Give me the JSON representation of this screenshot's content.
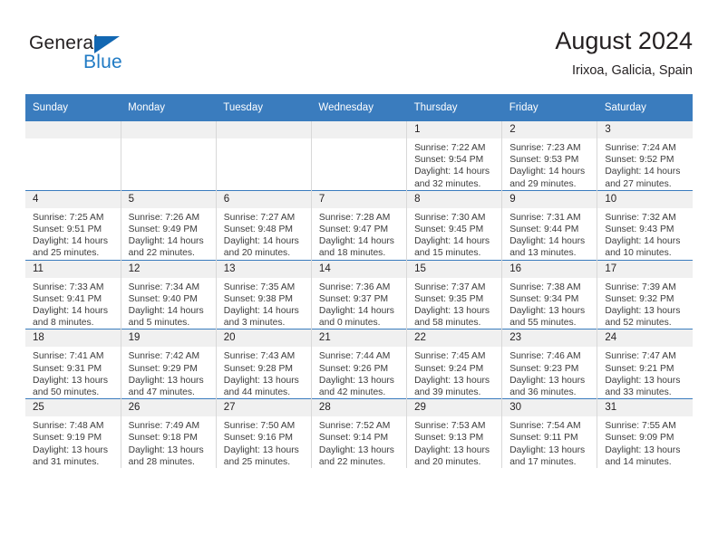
{
  "brand": {
    "name_part1": "General",
    "name_part2": "Blue",
    "logo_color": "#1267b2",
    "accent_color": "#1f7ac4"
  },
  "header": {
    "title": "August 2024",
    "subtitle": "Irixoa, Galicia, Spain"
  },
  "theme": {
    "header_row_color": "#3a7cbe",
    "daynum_band_color": "#f0f0f0",
    "text_color": "#231f20"
  },
  "calendar": {
    "weekday_headers": [
      "Sunday",
      "Monday",
      "Tuesday",
      "Wednesday",
      "Thursday",
      "Friday",
      "Saturday"
    ],
    "weeks": [
      [
        {
          "day": "",
          "sunrise": "",
          "sunset": "",
          "daylight_line1": "",
          "daylight_line2": ""
        },
        {
          "day": "",
          "sunrise": "",
          "sunset": "",
          "daylight_line1": "",
          "daylight_line2": ""
        },
        {
          "day": "",
          "sunrise": "",
          "sunset": "",
          "daylight_line1": "",
          "daylight_line2": ""
        },
        {
          "day": "",
          "sunrise": "",
          "sunset": "",
          "daylight_line1": "",
          "daylight_line2": ""
        },
        {
          "day": "1",
          "sunrise": "Sunrise: 7:22 AM",
          "sunset": "Sunset: 9:54 PM",
          "daylight_line1": "Daylight: 14 hours",
          "daylight_line2": "and 32 minutes."
        },
        {
          "day": "2",
          "sunrise": "Sunrise: 7:23 AM",
          "sunset": "Sunset: 9:53 PM",
          "daylight_line1": "Daylight: 14 hours",
          "daylight_line2": "and 29 minutes."
        },
        {
          "day": "3",
          "sunrise": "Sunrise: 7:24 AM",
          "sunset": "Sunset: 9:52 PM",
          "daylight_line1": "Daylight: 14 hours",
          "daylight_line2": "and 27 minutes."
        }
      ],
      [
        {
          "day": "4",
          "sunrise": "Sunrise: 7:25 AM",
          "sunset": "Sunset: 9:51 PM",
          "daylight_line1": "Daylight: 14 hours",
          "daylight_line2": "and 25 minutes."
        },
        {
          "day": "5",
          "sunrise": "Sunrise: 7:26 AM",
          "sunset": "Sunset: 9:49 PM",
          "daylight_line1": "Daylight: 14 hours",
          "daylight_line2": "and 22 minutes."
        },
        {
          "day": "6",
          "sunrise": "Sunrise: 7:27 AM",
          "sunset": "Sunset: 9:48 PM",
          "daylight_line1": "Daylight: 14 hours",
          "daylight_line2": "and 20 minutes."
        },
        {
          "day": "7",
          "sunrise": "Sunrise: 7:28 AM",
          "sunset": "Sunset: 9:47 PM",
          "daylight_line1": "Daylight: 14 hours",
          "daylight_line2": "and 18 minutes."
        },
        {
          "day": "8",
          "sunrise": "Sunrise: 7:30 AM",
          "sunset": "Sunset: 9:45 PM",
          "daylight_line1": "Daylight: 14 hours",
          "daylight_line2": "and 15 minutes."
        },
        {
          "day": "9",
          "sunrise": "Sunrise: 7:31 AM",
          "sunset": "Sunset: 9:44 PM",
          "daylight_line1": "Daylight: 14 hours",
          "daylight_line2": "and 13 minutes."
        },
        {
          "day": "10",
          "sunrise": "Sunrise: 7:32 AM",
          "sunset": "Sunset: 9:43 PM",
          "daylight_line1": "Daylight: 14 hours",
          "daylight_line2": "and 10 minutes."
        }
      ],
      [
        {
          "day": "11",
          "sunrise": "Sunrise: 7:33 AM",
          "sunset": "Sunset: 9:41 PM",
          "daylight_line1": "Daylight: 14 hours",
          "daylight_line2": "and 8 minutes."
        },
        {
          "day": "12",
          "sunrise": "Sunrise: 7:34 AM",
          "sunset": "Sunset: 9:40 PM",
          "daylight_line1": "Daylight: 14 hours",
          "daylight_line2": "and 5 minutes."
        },
        {
          "day": "13",
          "sunrise": "Sunrise: 7:35 AM",
          "sunset": "Sunset: 9:38 PM",
          "daylight_line1": "Daylight: 14 hours",
          "daylight_line2": "and 3 minutes."
        },
        {
          "day": "14",
          "sunrise": "Sunrise: 7:36 AM",
          "sunset": "Sunset: 9:37 PM",
          "daylight_line1": "Daylight: 14 hours",
          "daylight_line2": "and 0 minutes."
        },
        {
          "day": "15",
          "sunrise": "Sunrise: 7:37 AM",
          "sunset": "Sunset: 9:35 PM",
          "daylight_line1": "Daylight: 13 hours",
          "daylight_line2": "and 58 minutes."
        },
        {
          "day": "16",
          "sunrise": "Sunrise: 7:38 AM",
          "sunset": "Sunset: 9:34 PM",
          "daylight_line1": "Daylight: 13 hours",
          "daylight_line2": "and 55 minutes."
        },
        {
          "day": "17",
          "sunrise": "Sunrise: 7:39 AM",
          "sunset": "Sunset: 9:32 PM",
          "daylight_line1": "Daylight: 13 hours",
          "daylight_line2": "and 52 minutes."
        }
      ],
      [
        {
          "day": "18",
          "sunrise": "Sunrise: 7:41 AM",
          "sunset": "Sunset: 9:31 PM",
          "daylight_line1": "Daylight: 13 hours",
          "daylight_line2": "and 50 minutes."
        },
        {
          "day": "19",
          "sunrise": "Sunrise: 7:42 AM",
          "sunset": "Sunset: 9:29 PM",
          "daylight_line1": "Daylight: 13 hours",
          "daylight_line2": "and 47 minutes."
        },
        {
          "day": "20",
          "sunrise": "Sunrise: 7:43 AM",
          "sunset": "Sunset: 9:28 PM",
          "daylight_line1": "Daylight: 13 hours",
          "daylight_line2": "and 44 minutes."
        },
        {
          "day": "21",
          "sunrise": "Sunrise: 7:44 AM",
          "sunset": "Sunset: 9:26 PM",
          "daylight_line1": "Daylight: 13 hours",
          "daylight_line2": "and 42 minutes."
        },
        {
          "day": "22",
          "sunrise": "Sunrise: 7:45 AM",
          "sunset": "Sunset: 9:24 PM",
          "daylight_line1": "Daylight: 13 hours",
          "daylight_line2": "and 39 minutes."
        },
        {
          "day": "23",
          "sunrise": "Sunrise: 7:46 AM",
          "sunset": "Sunset: 9:23 PM",
          "daylight_line1": "Daylight: 13 hours",
          "daylight_line2": "and 36 minutes."
        },
        {
          "day": "24",
          "sunrise": "Sunrise: 7:47 AM",
          "sunset": "Sunset: 9:21 PM",
          "daylight_line1": "Daylight: 13 hours",
          "daylight_line2": "and 33 minutes."
        }
      ],
      [
        {
          "day": "25",
          "sunrise": "Sunrise: 7:48 AM",
          "sunset": "Sunset: 9:19 PM",
          "daylight_line1": "Daylight: 13 hours",
          "daylight_line2": "and 31 minutes."
        },
        {
          "day": "26",
          "sunrise": "Sunrise: 7:49 AM",
          "sunset": "Sunset: 9:18 PM",
          "daylight_line1": "Daylight: 13 hours",
          "daylight_line2": "and 28 minutes."
        },
        {
          "day": "27",
          "sunrise": "Sunrise: 7:50 AM",
          "sunset": "Sunset: 9:16 PM",
          "daylight_line1": "Daylight: 13 hours",
          "daylight_line2": "and 25 minutes."
        },
        {
          "day": "28",
          "sunrise": "Sunrise: 7:52 AM",
          "sunset": "Sunset: 9:14 PM",
          "daylight_line1": "Daylight: 13 hours",
          "daylight_line2": "and 22 minutes."
        },
        {
          "day": "29",
          "sunrise": "Sunrise: 7:53 AM",
          "sunset": "Sunset: 9:13 PM",
          "daylight_line1": "Daylight: 13 hours",
          "daylight_line2": "and 20 minutes."
        },
        {
          "day": "30",
          "sunrise": "Sunrise: 7:54 AM",
          "sunset": "Sunset: 9:11 PM",
          "daylight_line1": "Daylight: 13 hours",
          "daylight_line2": "and 17 minutes."
        },
        {
          "day": "31",
          "sunrise": "Sunrise: 7:55 AM",
          "sunset": "Sunset: 9:09 PM",
          "daylight_line1": "Daylight: 13 hours",
          "daylight_line2": "and 14 minutes."
        }
      ]
    ]
  }
}
